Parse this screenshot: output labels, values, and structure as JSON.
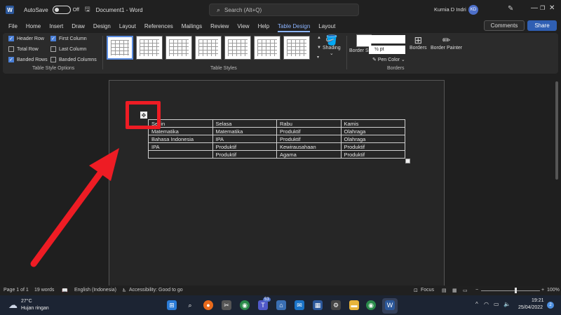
{
  "titlebar": {
    "autosave_label": "AutoSave",
    "autosave_state": "Off",
    "document_title": "Document1 - Word",
    "search_placeholder": "Search (Alt+Q)",
    "user_name": "Kurnia D Indri",
    "user_initials": "KD"
  },
  "tabs": [
    "File",
    "Home",
    "Insert",
    "Draw",
    "Design",
    "Layout",
    "References",
    "Mailings",
    "Review",
    "View",
    "Help",
    "Table Design",
    "Layout"
  ],
  "active_tab_index": 11,
  "header_buttons": {
    "comments": "Comments",
    "share": "Share"
  },
  "table_style_options": {
    "group_label": "Table Style Options",
    "options": [
      {
        "label": "Header Row",
        "checked": true
      },
      {
        "label": "First Column",
        "checked": true
      },
      {
        "label": "Total Row",
        "checked": false
      },
      {
        "label": "Last Column",
        "checked": false
      },
      {
        "label": "Banded Rows",
        "checked": true
      },
      {
        "label": "Banded Columns",
        "checked": false
      }
    ]
  },
  "table_styles": {
    "group_label": "Table Styles",
    "shading_label": "Shading"
  },
  "borders": {
    "group_label": "Borders",
    "border_styles_label": "Border Styles",
    "pen_weight": "½ pt",
    "pen_color_label": "Pen Color",
    "borders_label": "Borders",
    "border_painter_label": "Border Painter"
  },
  "document_table": {
    "rows": [
      [
        "Senin",
        "Selasa",
        "Rabu",
        "Kamis"
      ],
      [
        "Matematika",
        "Matematika",
        "Produktif",
        "Olahraga"
      ],
      [
        "Bahasa Indonesia",
        "IPA",
        "Produktif",
        "Olahraga"
      ],
      [
        "IPA",
        "Produktif",
        "Kewirausahaan",
        "Produktif"
      ],
      [
        "",
        "Produktif",
        "Agama",
        "Produktif"
      ]
    ]
  },
  "statusbar": {
    "page": "Page 1 of 1",
    "words": "19 words",
    "language": "English (Indonesia)",
    "accessibility": "Accessibility: Good to go",
    "focus": "Focus",
    "zoom": "100%"
  },
  "taskbar": {
    "temperature": "27°C",
    "weather": "Hujan ringan",
    "time": "19:21",
    "date": "25/04/2022",
    "notification_count": "2",
    "teams_badge": "53"
  },
  "colors": {
    "accent": "#8cb4ff",
    "share": "#2f5fb3",
    "highlight": "#ee1c24"
  }
}
